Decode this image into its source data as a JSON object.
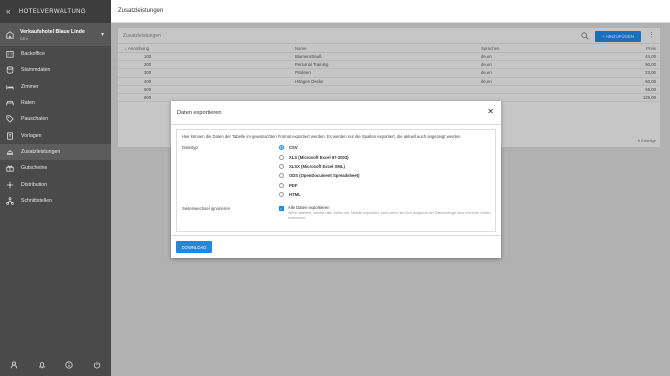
{
  "sidebar": {
    "app_title": "HOTELVERWALTUNG",
    "hotel_name": "Verkaufshotel Blaue Linde",
    "hotel_code": "DEV",
    "items": [
      {
        "label": "Backoffice",
        "icon": "building-icon"
      },
      {
        "label": "Stammdaten",
        "icon": "database-icon"
      },
      {
        "label": "Zimmer",
        "icon": "bed-icon"
      },
      {
        "label": "Raten",
        "icon": "sofa-icon"
      },
      {
        "label": "Pauschalen",
        "icon": "tag-icon"
      },
      {
        "label": "Vorlagen",
        "icon": "template-icon"
      },
      {
        "label": "Zusatzleistungen",
        "icon": "service-bell-icon",
        "active": true
      },
      {
        "label": "Gutscheine",
        "icon": "gift-icon"
      },
      {
        "label": "Distribution",
        "icon": "distribution-icon"
      },
      {
        "label": "Schnittstellen",
        "icon": "network-icon"
      }
    ],
    "bottom_icons": [
      "user-icon",
      "bell-icon",
      "help-icon",
      "power-icon"
    ]
  },
  "topbar": {
    "title": "Zusatzleistungen"
  },
  "card": {
    "title": "Zusatzleistungen",
    "add_label": "+ HINZUFÜGEN",
    "columns": {
      "order": "Anordnung",
      "name": "Name",
      "languages": "Sprachen",
      "price": "Preis"
    },
    "rows": [
      {
        "order": "100",
        "name": "Blumenstrauß",
        "languages": "de,en",
        "price": "44,00"
      },
      {
        "order": "200",
        "name": "Personal Training",
        "languages": "de,en",
        "price": "90,00"
      },
      {
        "order": "300",
        "name": "Pralinen",
        "languages": "de,en",
        "price": "23,00"
      },
      {
        "order": "400",
        "name": "Hängen Decke",
        "languages": "de,en",
        "price": "60,00"
      },
      {
        "order": "500",
        "name": "",
        "languages": "",
        "price": "65,00"
      },
      {
        "order": "600",
        "name": "",
        "languages": "",
        "price": "129,00"
      }
    ],
    "footer": "6 Einträge"
  },
  "modal": {
    "title": "Daten exportieren",
    "intro": "Hier können die Daten der Tabelle im gewünschten Format exportiert werden. Es werden nur die Spalten exportiert, die aktuell auch angezeigt werden.",
    "filetype_label": "Dateityp",
    "options": [
      {
        "label": "CSV",
        "selected": true
      },
      {
        "label": "XLS (Microsoft Excel 97-2003)",
        "selected": false
      },
      {
        "label": "XLSX (Microsoft Excel XML)",
        "selected": false
      },
      {
        "label": "ODS (OpenDocument Spreadsheet)",
        "selected": false
      },
      {
        "label": "PDF",
        "selected": false
      },
      {
        "label": "HTML",
        "selected": false
      }
    ],
    "pagination_label": "Seitenwechsel ignorieren",
    "checkbox_label": "Alle Daten exportieren",
    "checkbox_checked": true,
    "checkbox_hint": "Wenn aktiviert, werden alle Zeilen der Tabelle exportiert, auch wenn sie sich aufgrund der Datenmenge über mehrere Seiten erstrecken.",
    "download_label": "DOWNLOAD"
  },
  "colors": {
    "accent": "#1e88e5",
    "sidebar": "#4a4a4a"
  }
}
